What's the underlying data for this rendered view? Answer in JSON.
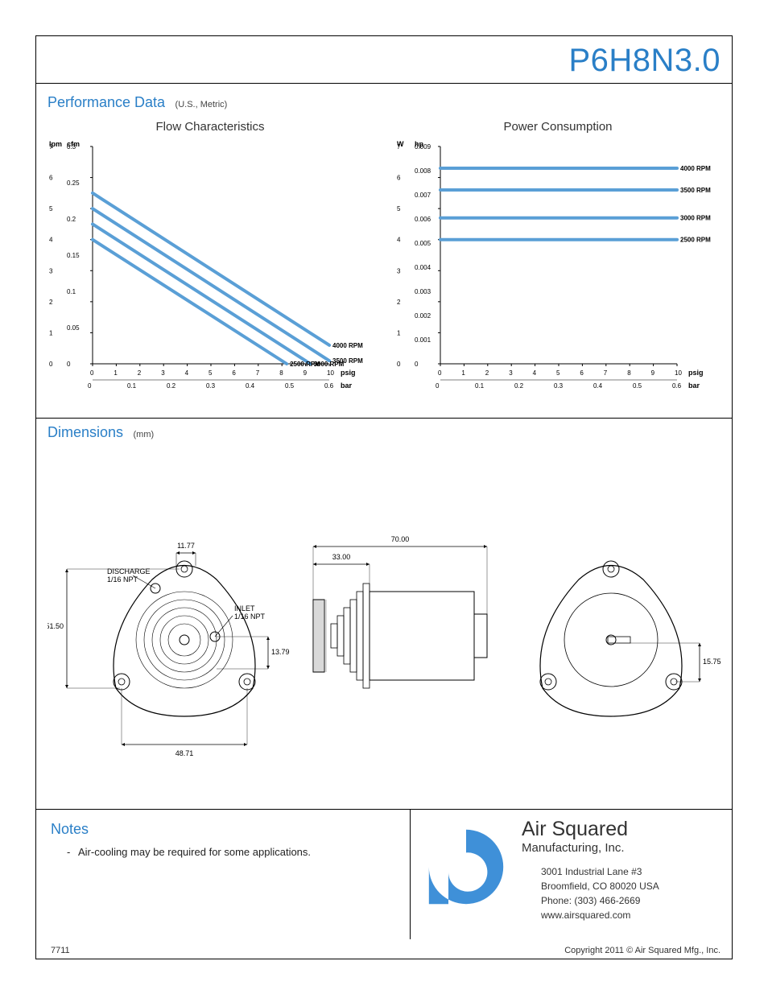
{
  "header": {
    "product_id": "P6H8N3.0"
  },
  "sections": {
    "performance": {
      "title": "Performance Data",
      "units": "(U.S., Metric)"
    },
    "dimensions": {
      "title": "Dimensions",
      "units": "(mm)"
    },
    "notes": {
      "title": "Notes"
    }
  },
  "notes": {
    "items": [
      "Air-cooling may be required for some applications."
    ]
  },
  "company": {
    "name": "Air Squared",
    "sub": "Manufacturing, Inc.",
    "addr1": "3001 Industrial Lane #3",
    "addr2": "Broomfield, CO 80020 USA",
    "phone": "Phone: (303) 466-2669",
    "web": "www.airsquared.com"
  },
  "footer": {
    "left": "7711",
    "right": "Copyright 2011 © Air Squared Mfg., Inc."
  },
  "dimensions_labels": {
    "discharge": "DISCHARGE\n1/16 NPT",
    "inlet": "INLET\n1/16 NPT",
    "d1": "11.77",
    "d2": "51.50",
    "d3": "48.71",
    "d4": "13.79",
    "d5": "70.00",
    "d6": "33.00",
    "d7": "15.75"
  },
  "chart_data": [
    {
      "title": "Flow Characteristics",
      "type": "line",
      "x": {
        "labels": [
          [
            "psig",
            [
              0,
              1,
              2,
              3,
              4,
              5,
              6,
              7,
              8,
              9,
              10
            ]
          ],
          [
            "bar",
            [
              0,
              0.1,
              0.2,
              0.3,
              0.4,
              0.5,
              0.6
            ]
          ]
        ],
        "range": [
          0,
          10
        ]
      },
      "y": {
        "labels": [
          [
            "lpm",
            [
              0,
              1,
              2,
              3,
              4,
              5,
              6,
              7
            ]
          ],
          [
            "cfm",
            [
              0,
              0.05,
              0.1,
              0.15,
              0.2,
              0.25,
              0.3
            ]
          ]
        ],
        "range": [
          0,
          7
        ]
      },
      "series": [
        {
          "name": "4000 RPM",
          "points": [
            [
              0,
              5.5
            ],
            [
              10,
              0.6
            ]
          ]
        },
        {
          "name": "3500 RPM",
          "points": [
            [
              0,
              5.0
            ],
            [
              10,
              0.1
            ]
          ]
        },
        {
          "name": "3000 RPM",
          "points": [
            [
              0,
              4.5
            ],
            [
              9.2,
              0
            ]
          ]
        },
        {
          "name": "2500 RPM",
          "points": [
            [
              0,
              4.0
            ],
            [
              8.2,
              0
            ]
          ]
        }
      ]
    },
    {
      "title": "Power Consumption",
      "type": "line",
      "x": {
        "labels": [
          [
            "psig",
            [
              0,
              1,
              2,
              3,
              4,
              5,
              6,
              7,
              8,
              9,
              10
            ]
          ],
          [
            "bar",
            [
              0,
              0.1,
              0.2,
              0.3,
              0.4,
              0.5,
              0.6
            ]
          ]
        ],
        "range": [
          0,
          10
        ]
      },
      "y": {
        "labels": [
          [
            "W",
            [
              0,
              1,
              2,
              3,
              4,
              5,
              6,
              7
            ]
          ],
          [
            "hp",
            [
              0,
              0.001,
              0.002,
              0.003,
              0.004,
              0.005,
              0.006,
              0.007,
              0.008,
              0.009
            ]
          ]
        ],
        "range": [
          0,
          7
        ]
      },
      "series": [
        {
          "name": "4000 RPM",
          "points": [
            [
              0,
              6.3
            ],
            [
              10,
              6.3
            ]
          ]
        },
        {
          "name": "3500 RPM",
          "points": [
            [
              0,
              5.6
            ],
            [
              10,
              5.6
            ]
          ]
        },
        {
          "name": "3000 RPM",
          "points": [
            [
              0,
              4.7
            ],
            [
              10,
              4.7
            ]
          ]
        },
        {
          "name": "2500 RPM",
          "points": [
            [
              0,
              4.0
            ],
            [
              10,
              4.0
            ]
          ]
        }
      ]
    }
  ]
}
